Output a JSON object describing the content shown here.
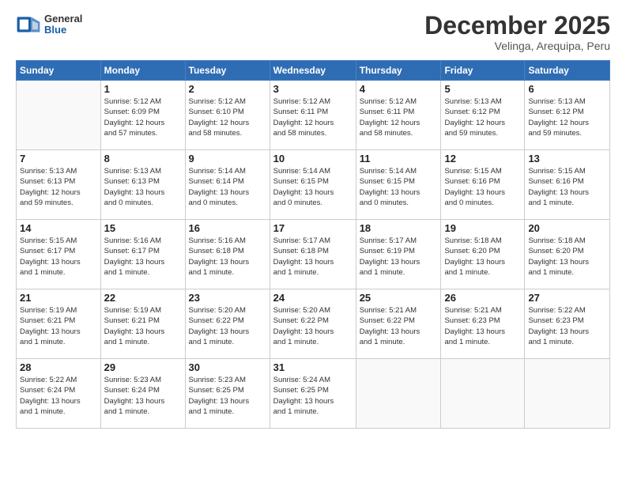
{
  "header": {
    "logo_general": "General",
    "logo_blue": "Blue",
    "month_title": "December 2025",
    "location": "Velinga, Arequipa, Peru"
  },
  "days_of_week": [
    "Sunday",
    "Monday",
    "Tuesday",
    "Wednesday",
    "Thursday",
    "Friday",
    "Saturday"
  ],
  "weeks": [
    [
      {
        "day": "",
        "info": ""
      },
      {
        "day": "1",
        "info": "Sunrise: 5:12 AM\nSunset: 6:09 PM\nDaylight: 12 hours\nand 57 minutes."
      },
      {
        "day": "2",
        "info": "Sunrise: 5:12 AM\nSunset: 6:10 PM\nDaylight: 12 hours\nand 58 minutes."
      },
      {
        "day": "3",
        "info": "Sunrise: 5:12 AM\nSunset: 6:11 PM\nDaylight: 12 hours\nand 58 minutes."
      },
      {
        "day": "4",
        "info": "Sunrise: 5:12 AM\nSunset: 6:11 PM\nDaylight: 12 hours\nand 58 minutes."
      },
      {
        "day": "5",
        "info": "Sunrise: 5:13 AM\nSunset: 6:12 PM\nDaylight: 12 hours\nand 59 minutes."
      },
      {
        "day": "6",
        "info": "Sunrise: 5:13 AM\nSunset: 6:12 PM\nDaylight: 12 hours\nand 59 minutes."
      }
    ],
    [
      {
        "day": "7",
        "info": "Sunrise: 5:13 AM\nSunset: 6:13 PM\nDaylight: 12 hours\nand 59 minutes."
      },
      {
        "day": "8",
        "info": "Sunrise: 5:13 AM\nSunset: 6:13 PM\nDaylight: 13 hours\nand 0 minutes."
      },
      {
        "day": "9",
        "info": "Sunrise: 5:14 AM\nSunset: 6:14 PM\nDaylight: 13 hours\nand 0 minutes."
      },
      {
        "day": "10",
        "info": "Sunrise: 5:14 AM\nSunset: 6:15 PM\nDaylight: 13 hours\nand 0 minutes."
      },
      {
        "day": "11",
        "info": "Sunrise: 5:14 AM\nSunset: 6:15 PM\nDaylight: 13 hours\nand 0 minutes."
      },
      {
        "day": "12",
        "info": "Sunrise: 5:15 AM\nSunset: 6:16 PM\nDaylight: 13 hours\nand 0 minutes."
      },
      {
        "day": "13",
        "info": "Sunrise: 5:15 AM\nSunset: 6:16 PM\nDaylight: 13 hours\nand 1 minute."
      }
    ],
    [
      {
        "day": "14",
        "info": "Sunrise: 5:15 AM\nSunset: 6:17 PM\nDaylight: 13 hours\nand 1 minute."
      },
      {
        "day": "15",
        "info": "Sunrise: 5:16 AM\nSunset: 6:17 PM\nDaylight: 13 hours\nand 1 minute."
      },
      {
        "day": "16",
        "info": "Sunrise: 5:16 AM\nSunset: 6:18 PM\nDaylight: 13 hours\nand 1 minute."
      },
      {
        "day": "17",
        "info": "Sunrise: 5:17 AM\nSunset: 6:18 PM\nDaylight: 13 hours\nand 1 minute."
      },
      {
        "day": "18",
        "info": "Sunrise: 5:17 AM\nSunset: 6:19 PM\nDaylight: 13 hours\nand 1 minute."
      },
      {
        "day": "19",
        "info": "Sunrise: 5:18 AM\nSunset: 6:20 PM\nDaylight: 13 hours\nand 1 minute."
      },
      {
        "day": "20",
        "info": "Sunrise: 5:18 AM\nSunset: 6:20 PM\nDaylight: 13 hours\nand 1 minute."
      }
    ],
    [
      {
        "day": "21",
        "info": "Sunrise: 5:19 AM\nSunset: 6:21 PM\nDaylight: 13 hours\nand 1 minute."
      },
      {
        "day": "22",
        "info": "Sunrise: 5:19 AM\nSunset: 6:21 PM\nDaylight: 13 hours\nand 1 minute."
      },
      {
        "day": "23",
        "info": "Sunrise: 5:20 AM\nSunset: 6:22 PM\nDaylight: 13 hours\nand 1 minute."
      },
      {
        "day": "24",
        "info": "Sunrise: 5:20 AM\nSunset: 6:22 PM\nDaylight: 13 hours\nand 1 minute."
      },
      {
        "day": "25",
        "info": "Sunrise: 5:21 AM\nSunset: 6:22 PM\nDaylight: 13 hours\nand 1 minute."
      },
      {
        "day": "26",
        "info": "Sunrise: 5:21 AM\nSunset: 6:23 PM\nDaylight: 13 hours\nand 1 minute."
      },
      {
        "day": "27",
        "info": "Sunrise: 5:22 AM\nSunset: 6:23 PM\nDaylight: 13 hours\nand 1 minute."
      }
    ],
    [
      {
        "day": "28",
        "info": "Sunrise: 5:22 AM\nSunset: 6:24 PM\nDaylight: 13 hours\nand 1 minute."
      },
      {
        "day": "29",
        "info": "Sunrise: 5:23 AM\nSunset: 6:24 PM\nDaylight: 13 hours\nand 1 minute."
      },
      {
        "day": "30",
        "info": "Sunrise: 5:23 AM\nSunset: 6:25 PM\nDaylight: 13 hours\nand 1 minute."
      },
      {
        "day": "31",
        "info": "Sunrise: 5:24 AM\nSunset: 6:25 PM\nDaylight: 13 hours\nand 1 minute."
      },
      {
        "day": "",
        "info": ""
      },
      {
        "day": "",
        "info": ""
      },
      {
        "day": "",
        "info": ""
      }
    ]
  ]
}
